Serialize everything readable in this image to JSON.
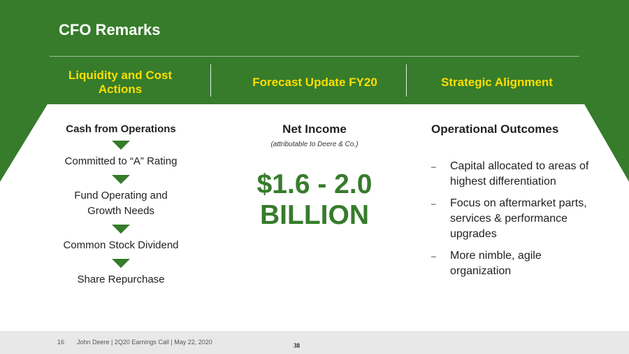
{
  "title": "CFO Remarks",
  "tabs": [
    "Liquidity and Cost Actions",
    "Forecast Update FY20",
    "Strategic Alignment"
  ],
  "cash_flow": {
    "heading": "Cash from Operations",
    "items": [
      "Committed to “A” Rating",
      "Fund Operating and Growth Needs",
      "Common Stock Dividend",
      "Share Repurchase"
    ]
  },
  "net_income": {
    "heading": "Net Income",
    "subheading": "(attributable to Deere & Co.)",
    "value": "$1.6 - 2.0 BILLION"
  },
  "outcomes": {
    "heading": "Operational Outcomes",
    "bullet_marker": "–",
    "items": [
      "Capital allocated to areas of highest differentiation",
      "Focus on aftermarket parts, services & performance upgrades",
      "More nimble, agile organization"
    ]
  },
  "footer": {
    "page_number": "16",
    "text": "John Deere | 2Q20 Earnings Call | May 22, 2020",
    "slide_number": "38"
  },
  "colors": {
    "brand_green": "#367c2b",
    "brand_yellow": "#ffde00"
  }
}
